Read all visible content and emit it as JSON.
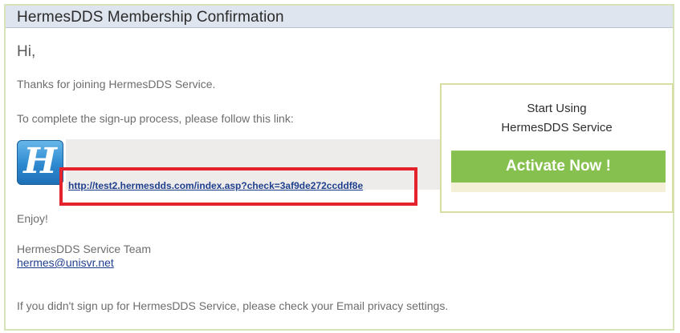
{
  "header": {
    "title": "HermesDDS Membership Confirmation"
  },
  "email": {
    "greeting": "Hi,",
    "thanks": "Thanks for joining HermesDDS Service.",
    "complete_instruction": "To complete the sign-up process, please follow this link:",
    "activation_link": "http://test2.hermesdds.com/index.asp?check=3af9de272ccddf8e",
    "enjoy": "Enjoy!",
    "team_name": "HermesDDS Service Team",
    "contact_email": "hermes@unisvr.net",
    "footer_note": "If you didn't sign up for HermesDDS Service, please check your Email privacy settings."
  },
  "logo": {
    "letter": "H",
    "icon": "hermes-logo-icon"
  },
  "promo": {
    "title_line_1": "Start Using",
    "title_line_2": "HermesDDS Service",
    "button_label": "Activate Now !"
  },
  "colors": {
    "header_bg": "#dfe5ee",
    "email_border": "#d7e3b8",
    "highlight_border": "#e3222c",
    "link": "#1f3f8f",
    "button_bg": "#86c04e",
    "promo_border": "#d8dda1"
  }
}
